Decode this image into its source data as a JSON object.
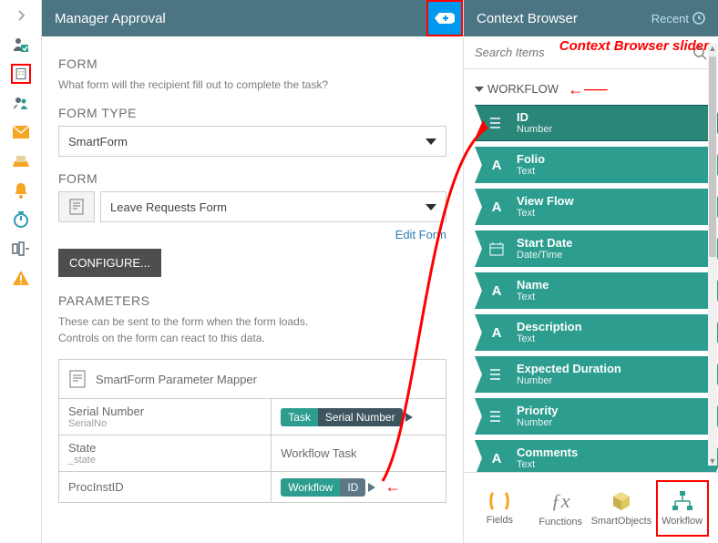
{
  "header": {
    "title": "Manager Approval"
  },
  "annotations": {
    "slider_label": "Context Browser slider"
  },
  "form": {
    "heading": "FORM",
    "sub": "What form will the recipient fill out to complete the task?",
    "type_label": "FORM TYPE",
    "type_value": "SmartForm",
    "form_label": "FORM",
    "form_value": "Leave Requests Form",
    "edit_link": "Edit Form",
    "configure": "CONFIGURE...",
    "params_heading": "PARAMETERS",
    "params_sub1": "These can be sent to the form when the form loads.",
    "params_sub2": " Controls on the form can react to this data.",
    "mapper_title": "SmartForm Parameter Mapper",
    "rows": [
      {
        "name": "Serial Number",
        "sub": "SerialNo",
        "token_a": "Task",
        "token_b": "Serial Number"
      },
      {
        "name": "State",
        "sub": "_state",
        "value_text": "Workflow Task"
      },
      {
        "name": "ProcInstID",
        "sub": "",
        "token_a": "Workflow",
        "token_b": "ID"
      }
    ]
  },
  "context": {
    "title": "Context Browser",
    "recent": "Recent",
    "search_placeholder": "Search Items",
    "group": "WORKFLOW",
    "items": [
      {
        "name": "ID",
        "type": "Number",
        "icon": "list"
      },
      {
        "name": "Folio",
        "type": "Text",
        "icon": "A"
      },
      {
        "name": "View Flow",
        "type": "Text",
        "icon": "A"
      },
      {
        "name": "Start Date",
        "type": "Date/Time",
        "icon": "cal"
      },
      {
        "name": "Name",
        "type": "Text",
        "icon": "A"
      },
      {
        "name": "Description",
        "type": "Text",
        "icon": "A"
      },
      {
        "name": "Expected Duration",
        "type": "Number",
        "icon": "list"
      },
      {
        "name": "Priority",
        "type": "Number",
        "icon": "list"
      },
      {
        "name": "Comments",
        "type": "Text",
        "icon": "A"
      }
    ],
    "tabs": {
      "fields": "Fields",
      "functions": "Functions",
      "smartobjects": "SmartObjects",
      "workflow": "Workflow"
    }
  }
}
